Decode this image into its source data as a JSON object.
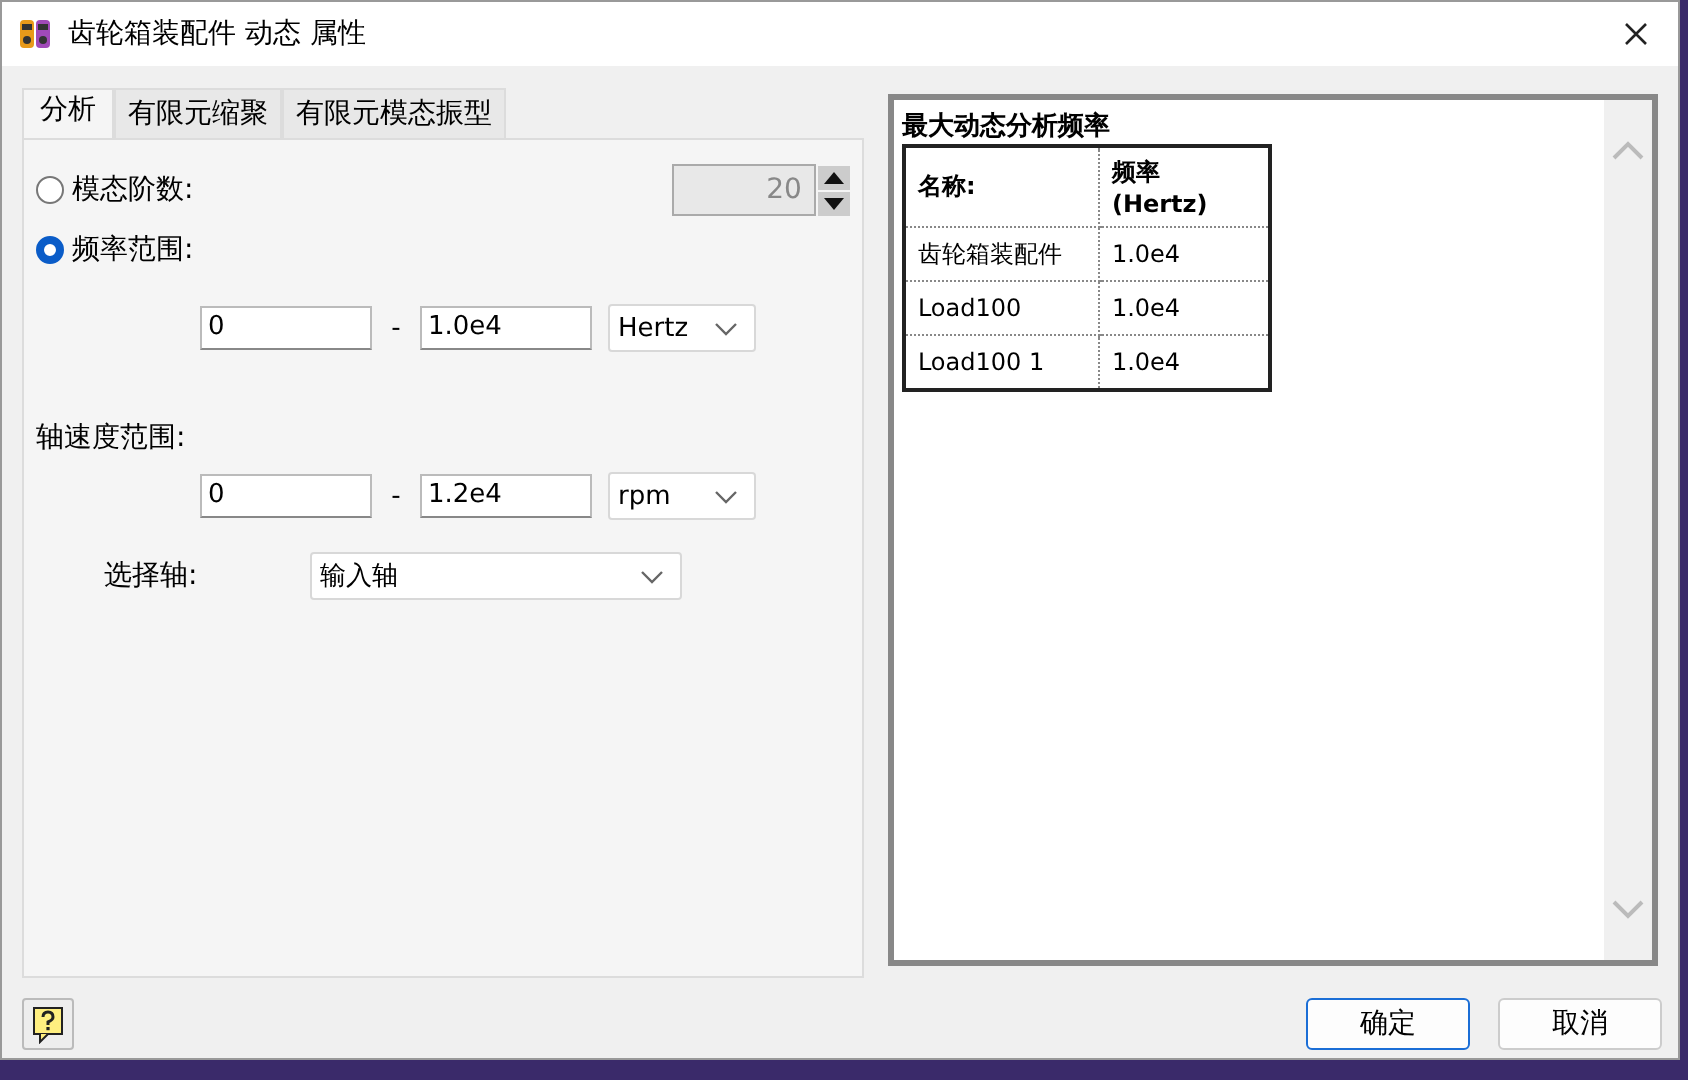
{
  "window": {
    "title": "齿轮箱装配件 动态 属性"
  },
  "tabs": [
    {
      "label": "分析",
      "selected": true
    },
    {
      "label": "有限元缩聚",
      "selected": false
    },
    {
      "label": "有限元模态振型",
      "selected": false
    }
  ],
  "options": [
    {
      "kind": "modes",
      "label": "模态阶数:",
      "selected": false
    },
    {
      "kind": "frequency",
      "label": "频率范围:",
      "selected": true
    }
  ],
  "mode_count": {
    "value": "20",
    "disabled": true
  },
  "frequency_range": {
    "from": "0",
    "separator": "-",
    "to": "1.0e4",
    "unit": "Hertz"
  },
  "shaft_speed": {
    "label": "轴速度范围:",
    "from": "0",
    "separator": "-",
    "to": "1.2e4",
    "unit": "rpm"
  },
  "shaft": {
    "label": "选择轴:",
    "value": "输入轴"
  },
  "results": {
    "title": "最大动态分析频率",
    "columns": [
      "名称:",
      "频率 (Hertz)"
    ],
    "rows": [
      [
        "齿轮箱装配件",
        "1.0e4"
      ],
      [
        "Load100",
        "1.0e4"
      ],
      [
        "Load100 1",
        "1.0e4"
      ]
    ]
  },
  "buttons": [
    {
      "label": "确定",
      "default": true
    },
    {
      "label": "取消",
      "default": false
    }
  ]
}
